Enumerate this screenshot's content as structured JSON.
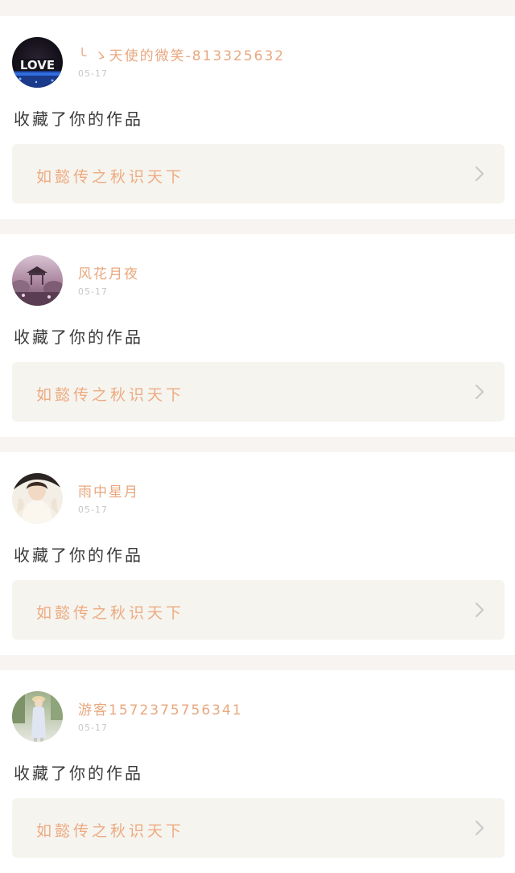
{
  "notifications": [
    {
      "username": "╰ ゝ天使的微笑-813325632",
      "time": "05-17",
      "action": "收藏了你的作品",
      "work_title": "如懿传之秋识天下",
      "avatar_icon": "love-sign-avatar"
    },
    {
      "username": "风花月夜",
      "time": "05-17",
      "action": "收藏了你的作品",
      "work_title": "如懿传之秋识天下",
      "avatar_icon": "pavilion-scene-avatar"
    },
    {
      "username": "雨中星月",
      "time": "05-17",
      "action": "收藏了你的作品",
      "work_title": "如懿传之秋识天下",
      "avatar_icon": "girl-portrait-avatar"
    },
    {
      "username": "游客1572375756341",
      "time": "05-17",
      "action": "收藏了你的作品",
      "work_title": "如懿传之秋识天下",
      "avatar_icon": "standing-figure-avatar"
    }
  ],
  "avatar_text": "LOVE",
  "colors": {
    "page_background": "#f7f4f2",
    "card_background": "#ffffff",
    "username": "#e9a77e",
    "work_title": "#eeab82",
    "work_box": "#f5f4ef",
    "time": "#c6c6c6",
    "action_text": "#3a3a3a"
  },
  "icons": {
    "chevron": "chevron-right-icon"
  }
}
